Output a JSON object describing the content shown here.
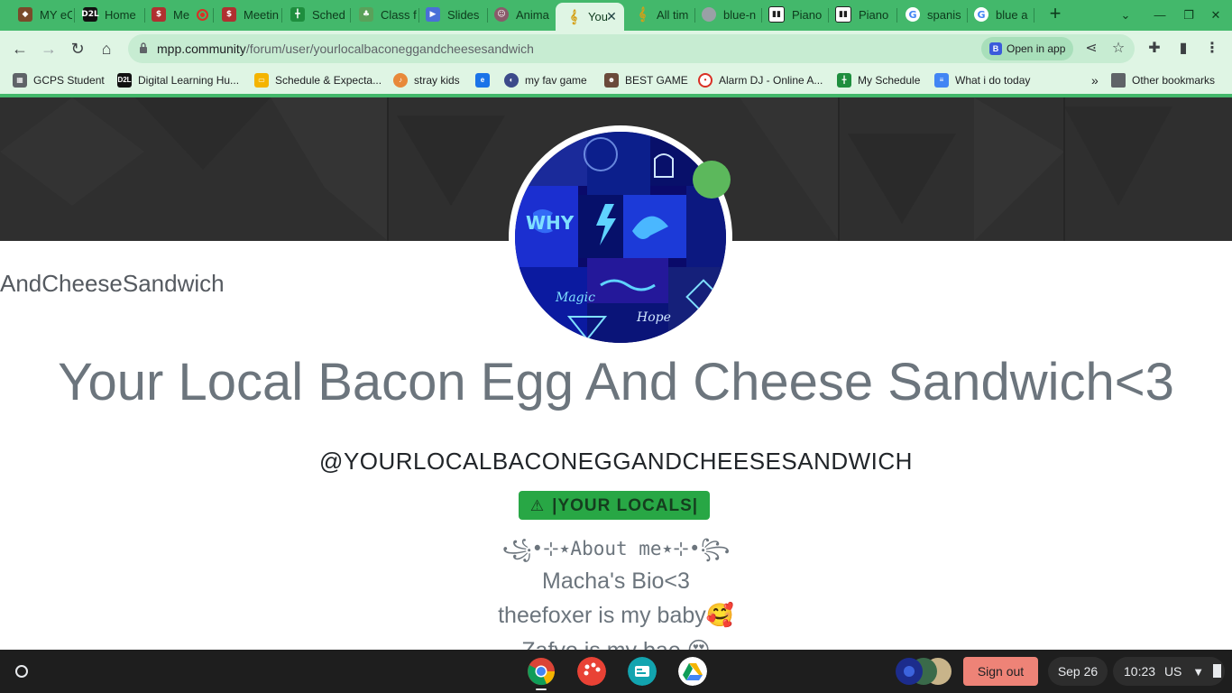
{
  "browser": {
    "tabs": [
      {
        "title": "MY eC",
        "icon": "owl-icon",
        "color": "#7a4a2a"
      },
      {
        "title": "Home",
        "icon": "d2l-icon",
        "color": "#111111"
      },
      {
        "title": "Me",
        "icon": "video-icon",
        "color": "#b03030"
      },
      {
        "title": "Meetin",
        "icon": "video-icon",
        "color": "#b03030"
      },
      {
        "title": "Sched",
        "icon": "sheets-icon",
        "color": "#1e8e3e"
      },
      {
        "title": "Class f",
        "icon": "classroom-icon",
        "color": "#5aa15a"
      },
      {
        "title": "Slides",
        "icon": "slides-icon",
        "color": "#4a6fd8"
      },
      {
        "title": "Anima",
        "icon": "face-icon",
        "color": "#8a5a6a"
      },
      {
        "title": "You",
        "icon": "music-note-icon",
        "color": "#d4a017"
      },
      {
        "title": "All tim",
        "icon": "music-note-icon",
        "color": "#d4a017"
      },
      {
        "title": "blue-n",
        "icon": "globe-icon",
        "color": "#9aa0a6"
      },
      {
        "title": "Piano",
        "icon": "piano-icon",
        "color": "#222222"
      },
      {
        "title": "Piano",
        "icon": "piano-icon",
        "color": "#222222"
      },
      {
        "title": "spanis",
        "icon": "google-icon",
        "color": "#4285f4"
      },
      {
        "title": "blue a",
        "icon": "google-icon",
        "color": "#4285f4"
      }
    ],
    "active_tab_index": 8,
    "url_host": "mpp.community",
    "url_path": "/forum/user/yourlocalbaconeggandcheesesandwich",
    "open_in_app_label": "Open in app",
    "bookmarks": [
      {
        "label": "GCPS Student",
        "color": "#5f6368"
      },
      {
        "label": "Digital Learning Hu...",
        "color": "#111111"
      },
      {
        "label": "Schedule & Expecta...",
        "color": "#f4b400"
      },
      {
        "label": "stray kids",
        "color": "#e8893a"
      },
      {
        "label": "",
        "color": "#1a73e8"
      },
      {
        "label": "my fav game",
        "color": "#3c4a8a"
      },
      {
        "label": "BEST GAME",
        "color": "#6a4a3a"
      },
      {
        "label": "Alarm DJ - Online A...",
        "color": "#d93025"
      },
      {
        "label": "My Schedule",
        "color": "#1e8e3e"
      },
      {
        "label": "What i do today",
        "color": "#4285f4"
      }
    ],
    "other_bookmarks_label": "Other bookmarks",
    "more_bookmarks_label": "»"
  },
  "profile": {
    "username_fragment": "AndCheeseSandwich",
    "display_name": "Your Local Bacon Egg And Cheese Sandwich<3",
    "handle": "@YOURLOCALBACONEGGANDCHEESESANDWICH",
    "rank_label": "|YOUR LOCALS|",
    "about_title": "꧁•⊹٭About me٭⊹•꧂",
    "bio_lines": [
      "Macha's Bio<3",
      "theefoxer is my baby🥰",
      "Zafyo is my bae 😍"
    ],
    "online_color": "#5cb85c",
    "rank_color": "#28a745"
  },
  "shelf": {
    "sign_out_label": "Sign out",
    "date": "Sep 26",
    "time": "10:23",
    "locale": "US"
  }
}
